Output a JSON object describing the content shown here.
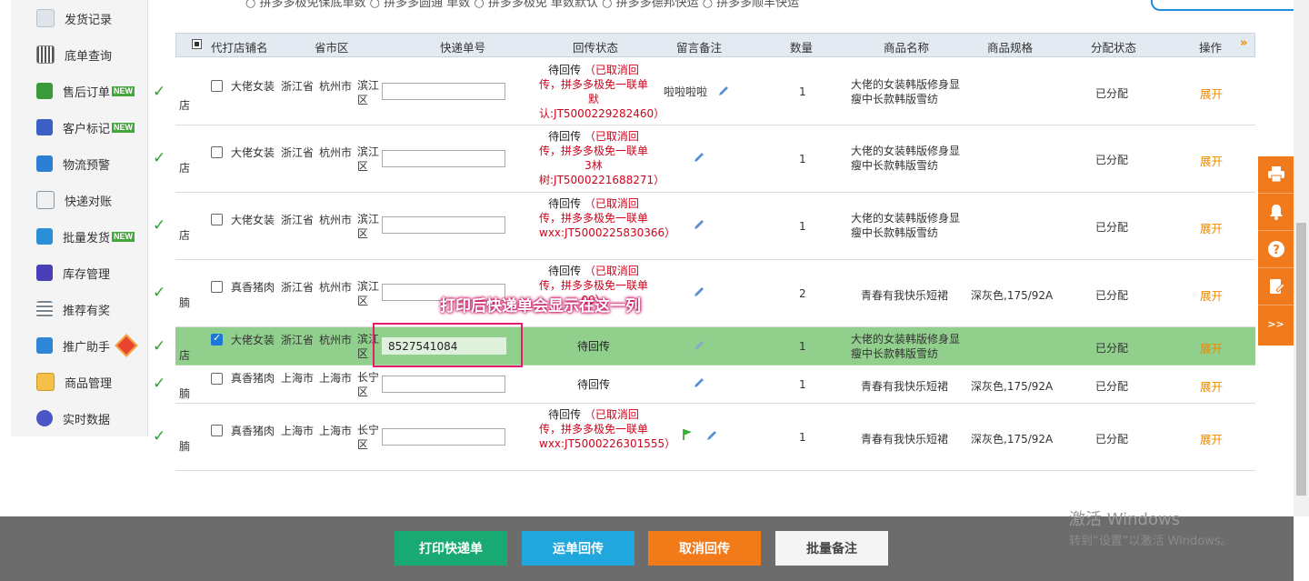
{
  "sidebar": {
    "items": [
      {
        "label": "发货记录",
        "icon": "shipping-record-icon",
        "badge": ""
      },
      {
        "label": "底单查询",
        "icon": "barcode-icon",
        "badge": ""
      },
      {
        "label": "售后订单",
        "icon": "after-sales-icon",
        "badge": "NEW"
      },
      {
        "label": "客户标记",
        "icon": "customer-tag-icon",
        "badge": "NEW"
      },
      {
        "label": "物流预警",
        "icon": "logistics-alert-icon",
        "badge": ""
      },
      {
        "label": "快递对账",
        "icon": "reconcile-icon",
        "badge": ""
      },
      {
        "label": "批量发货",
        "icon": "batch-ship-icon",
        "badge": "NEW"
      },
      {
        "label": "库存管理",
        "icon": "warehouse-icon",
        "badge": ""
      },
      {
        "label": "推荐有奖",
        "icon": "referral-icon",
        "badge": ""
      },
      {
        "label": "推广助手",
        "icon": "promotion-icon",
        "badge": ""
      },
      {
        "label": "商品管理",
        "icon": "product-icon",
        "badge": ""
      },
      {
        "label": "实时数据",
        "icon": "realtime-data-icon",
        "badge": ""
      }
    ]
  },
  "filters": {
    "line": "○ 拼多多极免保底单数 ○ 拼多多圆通 单数 ○ 拼多多极免 单数默认 ○ 拼多多德邦快运 ○ 拼多多顺丰快运"
  },
  "table": {
    "headers": [
      "代打店铺名",
      "省市区",
      "快递单号",
      "回传状态",
      "留言备注",
      "数量",
      "商品名称",
      "商品规格",
      "分配状态",
      "操作"
    ],
    "rows": [
      {
        "shop_suffix": "店",
        "shop": "大佬女装",
        "province": "浙江省",
        "city": "杭州市",
        "district": "滨江区",
        "tracking": "",
        "status": "待回传",
        "status_note": "（已取消回传，拼多多极免一联单默认:JT5000229282460）",
        "remark": "啦啦啦啦",
        "flag": false,
        "qty": "1",
        "product": "大佬的女装韩版修身显瘦中长款韩版雪纺",
        "spec": "",
        "assign": "已分配",
        "action": "展开",
        "checked": false
      },
      {
        "shop_suffix": "店",
        "shop": "大佬女装",
        "province": "浙江省",
        "city": "杭州市",
        "district": "滨江区",
        "tracking": "",
        "status": "待回传",
        "status_note": "（已取消回传，拼多多极免一联单3林树:JT5000221688271）",
        "remark": "",
        "flag": false,
        "qty": "1",
        "product": "大佬的女装韩版修身显瘦中长款韩版雪纺",
        "spec": "",
        "assign": "已分配",
        "action": "展开",
        "checked": false
      },
      {
        "shop_suffix": "店",
        "shop": "大佬女装",
        "province": "浙江省",
        "city": "杭州市",
        "district": "滨江区",
        "tracking": "",
        "status": "待回传",
        "status_note": "（已取消回传，拼多多极免一联单wxx:JT5000225830366）",
        "remark": "",
        "flag": false,
        "qty": "1",
        "product": "大佬的女装韩版修身显瘦中长款韩版雪纺",
        "spec": "",
        "assign": "已分配",
        "action": "展开",
        "checked": false
      },
      {
        "shop_suffix": "腩",
        "shop": "真香猪肉",
        "province": "浙江省",
        "city": "杭州市",
        "district": "滨江区",
        "tracking": "",
        "status": "待回传",
        "status_note": "（已取消回传，拼多多极免一联单",
        "status_tail": "00）",
        "remark": "",
        "flag": false,
        "qty": "2",
        "product": "青春有我快乐短裙",
        "spec": "深灰色,175/92A",
        "assign": "已分配",
        "action": "展开",
        "checked": false
      },
      {
        "shop_suffix": "店",
        "shop": "大佬女装",
        "province": "浙江省",
        "city": "杭州市",
        "district": "滨江区",
        "tracking": "8527541084",
        "status": "待回传",
        "status_note": "",
        "remark": "",
        "flag": false,
        "qty": "1",
        "product": "大佬的女装韩版修身显瘦中长款韩版雪纺",
        "spec": "",
        "assign": "已分配",
        "action": "展开",
        "checked": true
      },
      {
        "shop_suffix": "腩",
        "shop": "真香猪肉",
        "province": "上海市",
        "city": "上海市",
        "district": "长宁区",
        "tracking": "",
        "status": "待回传",
        "status_note": "",
        "remark": "",
        "flag": false,
        "qty": "1",
        "product": "青春有我快乐短裙",
        "spec": "深灰色,175/92A",
        "assign": "已分配",
        "action": "展开",
        "checked": false
      },
      {
        "shop_suffix": "腩",
        "shop": "真香猪肉",
        "province": "上海市",
        "city": "上海市",
        "district": "长宁区",
        "tracking": "",
        "status": "待回传",
        "status_note": "（已取消回传，拼多多极免一联单wxx:JT5000226301555）",
        "remark": "",
        "flag": true,
        "qty": "1",
        "product": "青春有我快乐短裙",
        "spec": "深灰色,175/92A",
        "assign": "已分配",
        "action": "展开",
        "checked": false
      }
    ]
  },
  "callout": {
    "text": "打印后快递单会显示在这一列"
  },
  "float_toolbar": [
    {
      "icon": "printer-icon"
    },
    {
      "icon": "bell-icon"
    },
    {
      "icon": "help-icon"
    },
    {
      "icon": "edit-note-icon"
    },
    {
      "icon": "expand-icon",
      "label": ">>"
    }
  ],
  "actions": {
    "print": {
      "label": "打印快递单",
      "color": "#19aa73"
    },
    "return": {
      "label": "运单回传",
      "color": "#1fa7de"
    },
    "cancel": {
      "label": "取消回传",
      "color": "#f27a18"
    },
    "batch_note": {
      "label": "批量备注",
      "color": "#f4f4f4"
    }
  },
  "watermark": {
    "line1": "激活 Windows",
    "line2": "转到“设置”以激活 Windows。"
  },
  "colors": {
    "selected_row": "#90cf8c",
    "accent_orange": "#f08a00",
    "status_red": "#d0021b",
    "callout_pink": "#e61d6d"
  }
}
